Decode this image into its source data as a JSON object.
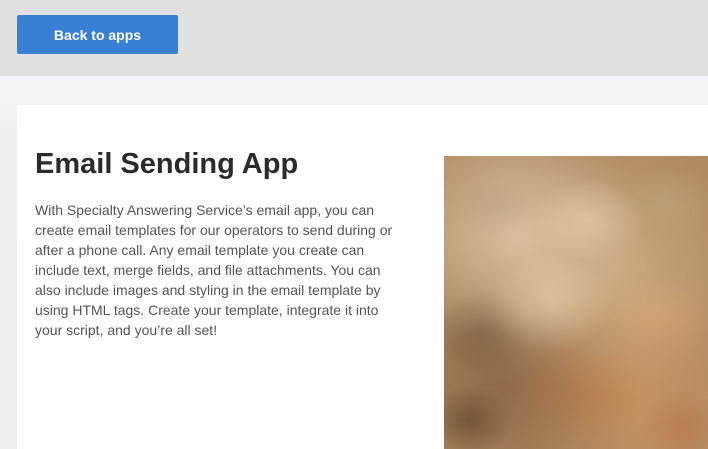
{
  "header": {
    "back_button_label": "Back to apps"
  },
  "main": {
    "title": "Email Sending App",
    "description": "With Specialty Answering Service’s email app, you can create email templates for our operators to send during or after a phone call. Any email template you create can include text, merge fields, and file attachments. You can also include images and styling in the email template by using HTML tags. Create your template, integrate it into your script, and you’re all set!"
  }
}
